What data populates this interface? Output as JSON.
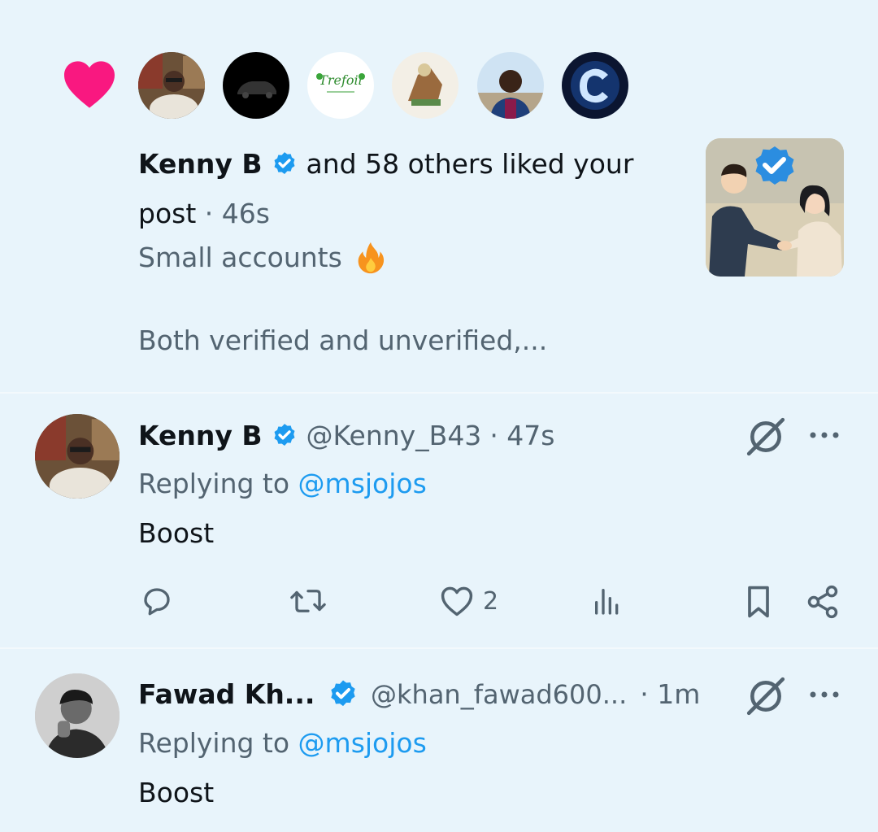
{
  "like_notification": {
    "actor": "Kenny B",
    "text_line1": "and 58 others liked your",
    "text_line2": "post",
    "time": "· 46s",
    "post_preview_line1": "Small accounts",
    "post_preview_line2": "Both verified and unverified,...",
    "avatars": [
      "kenny-b-avatar",
      "car-avatar",
      "trefoil-avatar",
      "cartoon-avatar",
      "man-avatar",
      "c-logo-avatar"
    ]
  },
  "reply1": {
    "name": "Kenny B",
    "handle": "@Kenny_B43",
    "time": "· 47s",
    "replying_prefix": "Replying to",
    "replying_handle": "@msjojos",
    "body": "Boost",
    "likes": "2"
  },
  "reply2": {
    "name": "Fawad Kh...",
    "handle": "@khan_fawad600...",
    "time": "· 1m",
    "replying_prefix": "Replying to",
    "replying_handle": "@msjojos",
    "body": "Boost"
  },
  "colors": {
    "background": "#e8f4fb",
    "verified": "#1d9bf0",
    "heart": "#f91880",
    "link": "#1d9bf0",
    "secondary_text": "#536471"
  }
}
